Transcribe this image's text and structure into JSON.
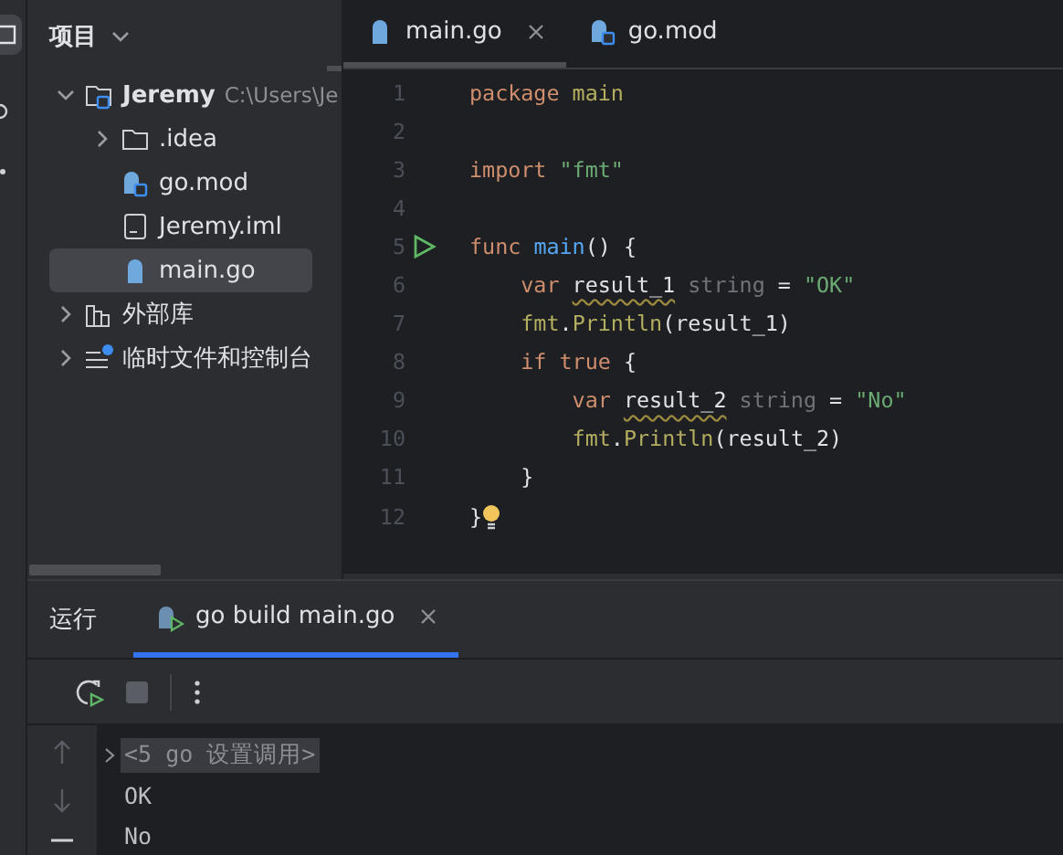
{
  "project_panel": {
    "title": "项目",
    "tree": [
      {
        "label": "Jeremy",
        "kind": "project",
        "hint": "C:\\Users\\Je",
        "expanded": true,
        "selected": false,
        "children": [
          {
            "label": ".idea",
            "kind": "folder",
            "expanded": false,
            "selected": false
          },
          {
            "label": "go.mod",
            "kind": "module",
            "selected": false
          },
          {
            "label": "Jeremy.iml",
            "kind": "file",
            "selected": false
          },
          {
            "label": "main.go",
            "kind": "gofile",
            "selected": true
          }
        ]
      },
      {
        "label": "外部库",
        "kind": "library",
        "expanded": false,
        "selected": false
      },
      {
        "label": "临时文件和控制台",
        "kind": "scratches",
        "expanded": false,
        "selected": false
      }
    ]
  },
  "editor": {
    "tabs": [
      {
        "label": "main.go",
        "kind": "gofile",
        "selected": true,
        "closable": true
      },
      {
        "label": "go.mod",
        "kind": "module",
        "selected": false,
        "closable": false
      }
    ],
    "lines": [
      {
        "number": "1",
        "tokens": [
          {
            "text": "package ",
            "kind": "keyword"
          },
          {
            "text": "main",
            "kind": "package"
          }
        ]
      },
      {
        "number": "2"
      },
      {
        "number": "3",
        "tokens": [
          {
            "text": "import ",
            "kind": "keyword"
          },
          {
            "text": "\"fmt\"",
            "kind": "string"
          }
        ]
      },
      {
        "number": "4"
      },
      {
        "number": "5",
        "run": true,
        "tokens": [
          {
            "text": "func ",
            "kind": "keyword"
          },
          {
            "text": "main",
            "kind": "function"
          },
          {
            "text": "() {"
          }
        ]
      },
      {
        "number": "6",
        "tokens": [
          {
            "text": "    var ",
            "kind": "keyword"
          },
          {
            "text": "result_1",
            "kind": "warning"
          },
          {
            "text": " string",
            "kind": "type"
          },
          {
            "text": " = "
          },
          {
            "text": "\"OK\"",
            "kind": "string"
          }
        ]
      },
      {
        "number": "7",
        "tokens": [
          {
            "text": "    fmt",
            "kind": "package"
          },
          {
            "text": "."
          },
          {
            "text": "Println",
            "kind": "package"
          },
          {
            "text": "(result_1)"
          }
        ]
      },
      {
        "number": "8",
        "tokens": [
          {
            "text": "    if ",
            "kind": "keyword"
          },
          {
            "text": "true",
            "kind": "keyword"
          },
          {
            "text": " {"
          }
        ]
      },
      {
        "number": "9",
        "tokens": [
          {
            "text": "        var ",
            "kind": "keyword"
          },
          {
            "text": "result_2",
            "kind": "warning"
          },
          {
            "text": " string",
            "kind": "type"
          },
          {
            "text": " = "
          },
          {
            "text": "\"No\"",
            "kind": "string"
          }
        ]
      },
      {
        "number": "10",
        "tokens": [
          {
            "text": "        fmt",
            "kind": "package"
          },
          {
            "text": "."
          },
          {
            "text": "Println",
            "kind": "package"
          },
          {
            "text": "(result_2)"
          }
        ]
      },
      {
        "number": "11",
        "tokens": [
          {
            "text": "    }"
          }
        ]
      },
      {
        "number": "12",
        "hint": true,
        "tokens": [
          {
            "text": "}"
          }
        ]
      }
    ]
  },
  "run_panel": {
    "title": "运行",
    "tabs": [
      {
        "label": "go build main.go",
        "selected": true,
        "closable": true
      }
    ],
    "output": [
      {
        "text": "<5 go 设置调用>",
        "kind": "folded"
      },
      {
        "text": "OK",
        "kind": "stdout"
      },
      {
        "text": "No",
        "kind": "stdout"
      }
    ]
  }
}
